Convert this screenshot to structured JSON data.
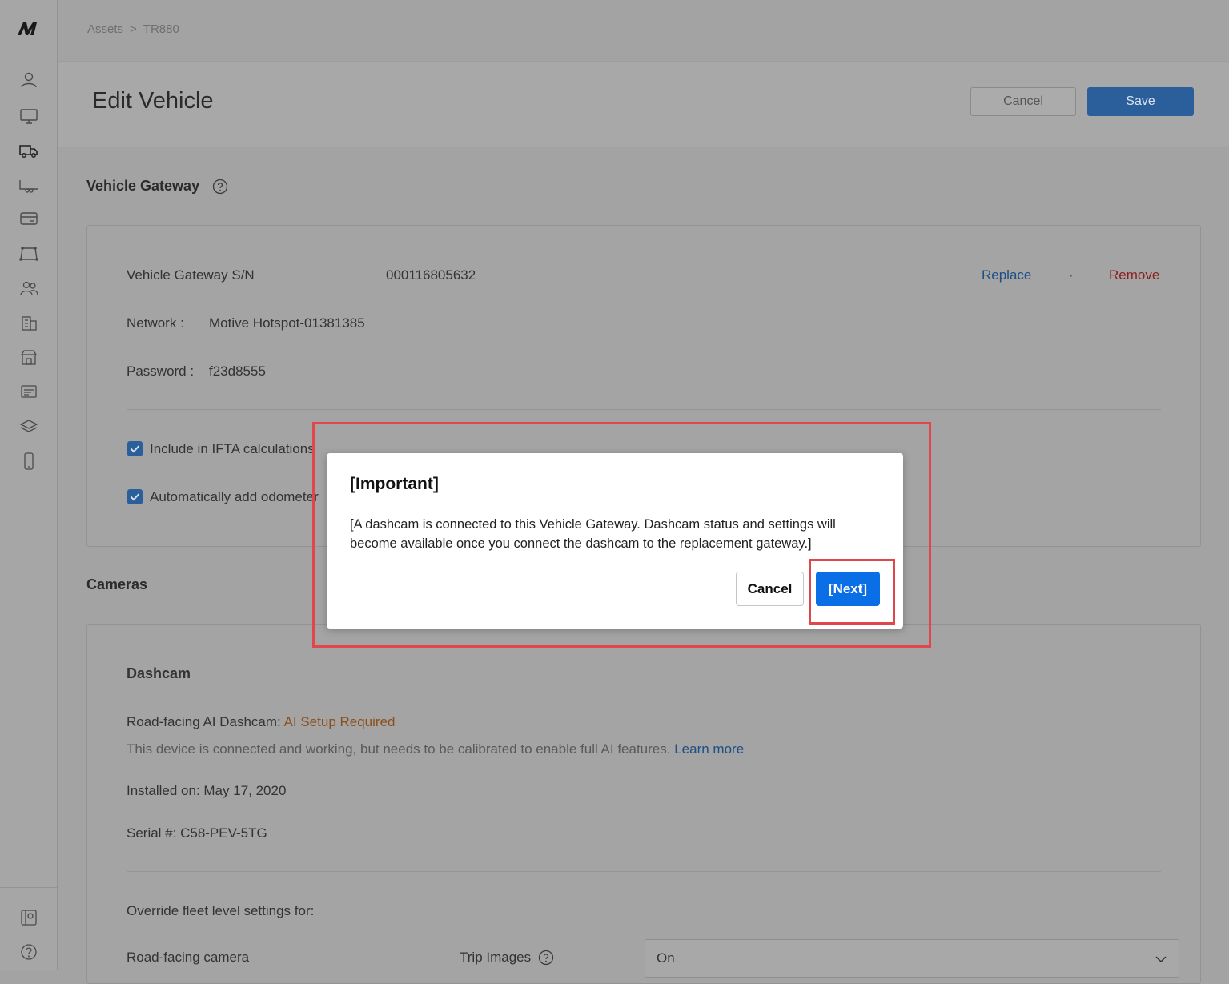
{
  "breadcrumb": {
    "parent": "Assets",
    "separator": ">",
    "current": "TR880"
  },
  "header": {
    "title": "Edit Vehicle",
    "cancel_label": "Cancel",
    "save_label": "Save"
  },
  "sidebar": {
    "items": [
      "user-icon",
      "monitor-icon",
      "truck-icon",
      "trailer-icon",
      "card-icon",
      "geofence-icon",
      "users-icon",
      "building-icon",
      "store-icon",
      "reports-icon",
      "layers-icon",
      "phone-icon"
    ],
    "bottom": [
      "map-pin-icon",
      "help-icon"
    ]
  },
  "gateway": {
    "section_title": "Vehicle Gateway",
    "sn_label": "Vehicle Gateway S/N",
    "sn_value": "000116805632",
    "replace_label": "Replace",
    "dot": "·",
    "remove_label": "Remove",
    "network_label": "Network :",
    "network_value": "Motive Hotspot-01381385",
    "password_label": "Password :",
    "password_value": "f23d8555",
    "ifta_label": "Include in IFTA calculations",
    "odometer_label": "Automatically add odometer"
  },
  "cameras": {
    "section_title": "Cameras",
    "dashcam_title": "Dashcam",
    "road_label": "Road-facing AI Dashcam:",
    "road_status": "AI Setup Required",
    "road_desc": "This device is connected and working, but needs to be calibrated to enable full AI features.",
    "learn_more": "Learn more",
    "installed": "Installed on: May 17, 2020",
    "serial": "Serial #: C58-PEV-5TG",
    "override_label": "Override fleet level settings for:",
    "road_camera_label": "Road-facing camera",
    "trip_images_label": "Trip Images",
    "trip_images_value": "On"
  },
  "modal": {
    "title": "[Important]",
    "body": "[A dashcam is connected to this Vehicle Gateway. Dashcam status and settings will become available once you connect the dashcam to the replacement gateway.]",
    "cancel_label": "Cancel",
    "next_label": "[Next]"
  },
  "colors": {
    "overlay": "#a3a3a3",
    "primary": "#0a6ee6",
    "highlight": "#e0464a",
    "link": "#1d4f85",
    "danger": "#8c1e1e",
    "warning": "#8c4f1a"
  }
}
